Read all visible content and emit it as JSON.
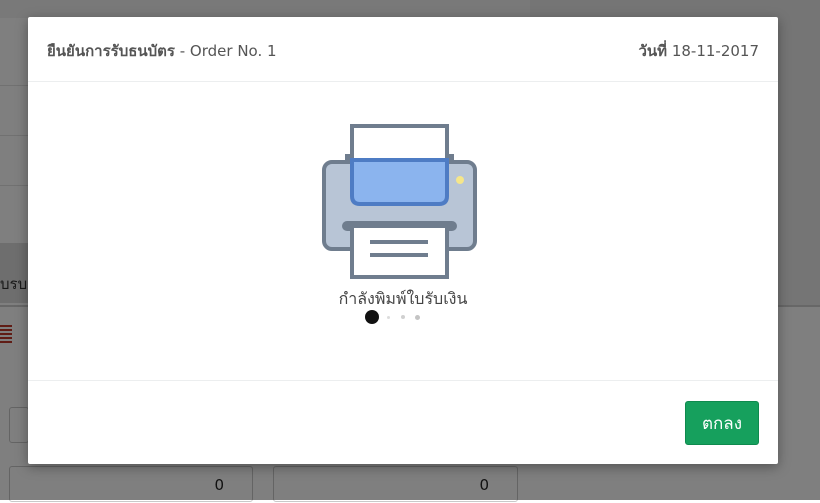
{
  "background": {
    "tab_label": "บรบ",
    "inputs": [
      {
        "value": "0"
      },
      {
        "value": "0"
      }
    ]
  },
  "modal": {
    "title_strong": "ยืนยันการรับธนบัตร",
    "title_rest": " - Order No. 1",
    "date_label": "วันที่",
    "date_value": " 18-11-2017",
    "status_text": "กำลังพิมพ์ใบรับเงิน",
    "printer_icon": "printer-icon",
    "loading_dots": {
      "count": 4,
      "active_index": 0
    },
    "ok_label": "ตกลง"
  },
  "colors": {
    "ok_button": "#16a05d",
    "printer_paper_fill": "#8bb4ee",
    "printer_body": "#b8c5d6",
    "printer_outline": "#6f7d8e",
    "printer_led": "#f5e68a"
  }
}
